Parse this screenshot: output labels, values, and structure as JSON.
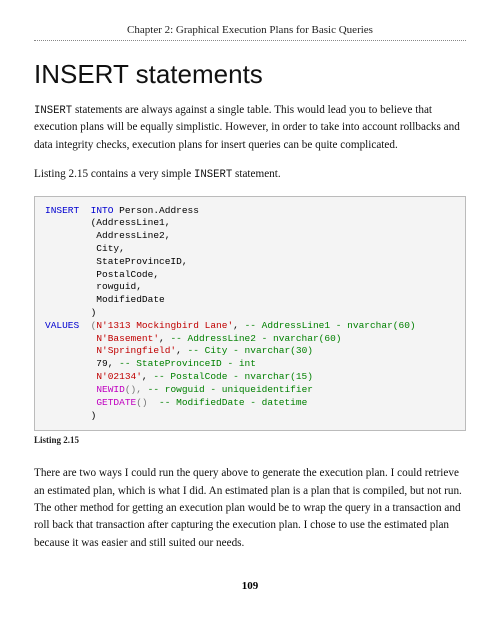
{
  "chapter": "Chapter 2: Graphical Execution Plans for Basic Queries",
  "heading": "INSERT statements",
  "para1_lead": "INSERT",
  "para1_rest": " statements are always against a single table. This would lead you to believe that execution plans will be equally simplistic. However, in order to take into account rollbacks and data integrity checks, execution plans for insert queries can be quite complicated.",
  "para2_a": "Listing 2.15 contains a very simple ",
  "para2_code": "INSERT",
  "para2_b": " statement.",
  "code": {
    "l01a": "INSERT",
    "l01b": "  INTO",
    "l01c": " Person.Address",
    "l02": "        (AddressLine1,",
    "l03": "         AddressLine2,",
    "l04": "         City,",
    "l05": "         StateProvinceID,",
    "l06": "         PostalCode,",
    "l07": "         rowguid,",
    "l08": "         ModifiedDate",
    "l09": "        )",
    "l10a": "VALUES",
    "l10b": "  (",
    "l10c": "N'1313 Mockingbird Lane'",
    "l10d": ", ",
    "l10e": "-- AddressLine1 - nvarchar(60)",
    "l11a": "         ",
    "l11b": "N'Basement'",
    "l11c": ", ",
    "l11d": "-- AddressLine2 - nvarchar(60)",
    "l12a": "         ",
    "l12b": "N'Springfield'",
    "l12c": ", ",
    "l12d": "-- City - nvarchar(30)",
    "l13a": "         79, ",
    "l13b": "-- StateProvinceID - int",
    "l14a": "         ",
    "l14b": "N'02134'",
    "l14c": ", ",
    "l14d": "-- PostalCode - nvarchar(15)",
    "l15a": "         ",
    "l15b": "NEWID",
    "l15c": "(), ",
    "l15d": "-- rowguid - uniqueidentifier",
    "l16a": "         ",
    "l16b": "GETDATE",
    "l16c": "()  ",
    "l16d": "-- ModifiedDate - datetime",
    "l17": "        )"
  },
  "listing_label": "Listing 2.15",
  "para3": "There are two ways I could run the query above to generate the execution plan. I could retrieve an estimated plan, which is what I did. An estimated plan is a plan that is compiled, but not run. The other method for getting an execution plan would be to wrap the query in a transaction and roll back that transaction after capturing the execution plan. I chose to use the estimated plan because it was easier and still suited our needs.",
  "page_number": "109"
}
